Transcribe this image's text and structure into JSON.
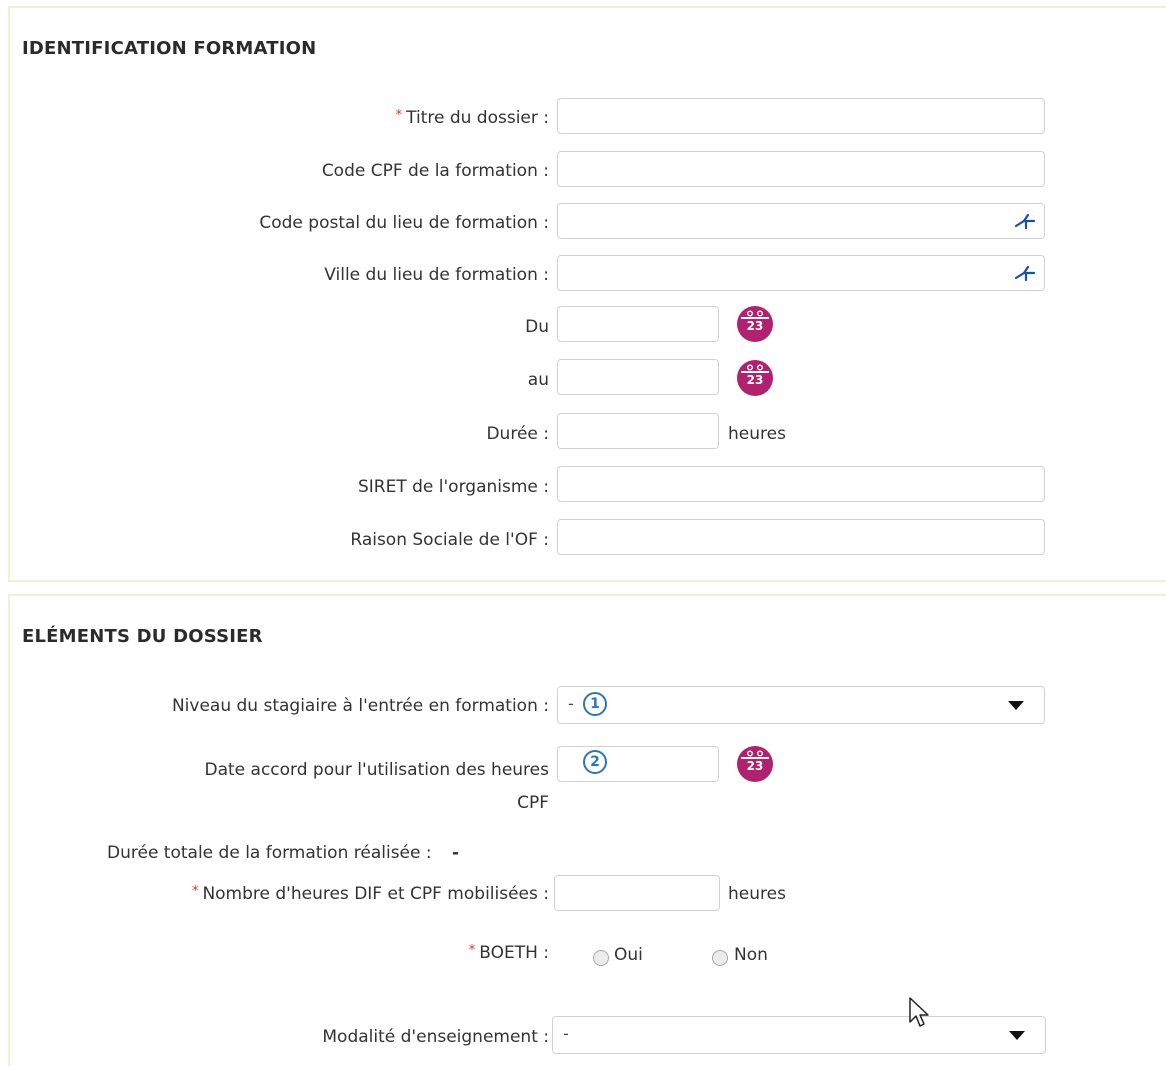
{
  "section1": {
    "title": "IDENTIFICATION FORMATION",
    "fields": {
      "titre_label": "Titre du dossier :",
      "code_cpf_label": "Code CPF de la formation :",
      "code_postal_label": "Code postal du lieu de formation :",
      "ville_label": "Ville du lieu de formation :",
      "du_label": "Du",
      "au_label": "au",
      "duree_label": "Durée :",
      "duree_unit": "heures",
      "siret_label": "SIRET de l'organisme :",
      "raison_label": "Raison Sociale de l'OF :"
    },
    "calendar_day": "23"
  },
  "section2": {
    "title": "ELÉMENTS DU DOSSIER",
    "niveau_label": "Niveau du stagiaire à l'entrée en formation :",
    "niveau_value": "-",
    "niveau_marker": "1",
    "date_accord_label_line1": "Date accord pour l'utilisation des heures",
    "date_accord_label_line2": "CPF",
    "date_accord_marker": "2",
    "duree_totale_label": "Durée totale de la formation réalisée :",
    "duree_totale_value": "-",
    "nb_heures_label": "Nombre d'heures DIF et CPF mobilisées :",
    "nb_heures_unit": "heures",
    "boeth_label": "BOETH :",
    "boeth_oui": "Oui",
    "boeth_non": "Non",
    "modalite_label": "Modalité d'enseignement :",
    "modalite_value": "-"
  },
  "required_mark": "*",
  "colors": {
    "accent": "#b0216f",
    "required": "#d32f2f",
    "marker": "#2e75b6",
    "panel_border": "#eef2da"
  }
}
